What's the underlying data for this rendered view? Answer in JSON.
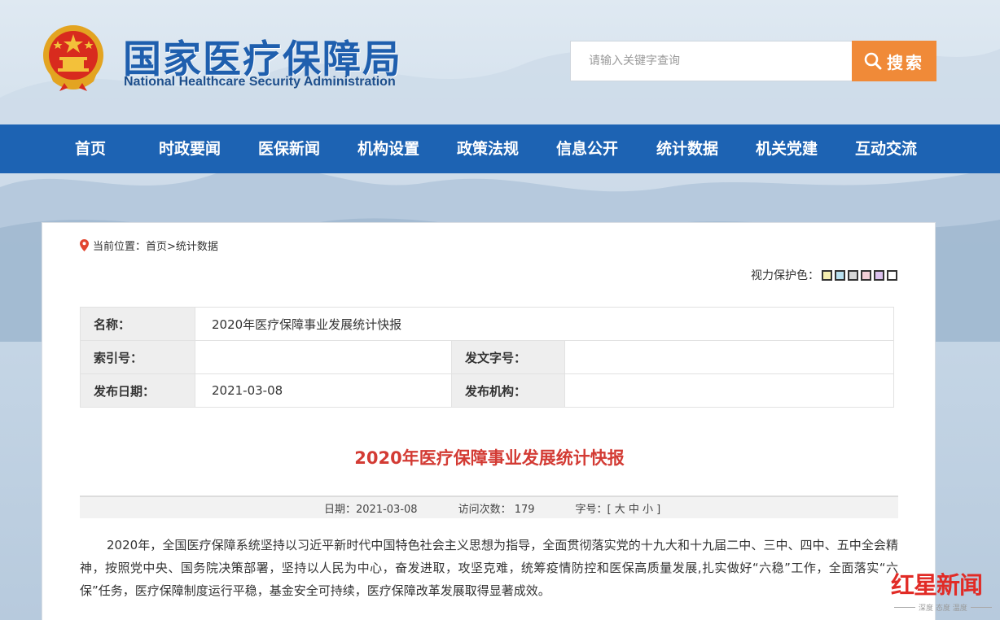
{
  "header": {
    "title_cn": "国家医疗保障局",
    "title_en": "National Healthcare Security Administration",
    "search_placeholder": "请输入关键字查询",
    "search_label": "搜索"
  },
  "nav": {
    "items": [
      "首页",
      "时政要闻",
      "医保新闻",
      "机构设置",
      "政策法规",
      "信息公开",
      "统计数据",
      "机关党建",
      "互动交流"
    ]
  },
  "breadcrumb": "当前位置：首页>统计数据",
  "eye_care": {
    "label": "视力保护色：",
    "colors": [
      "#f5eeb0",
      "#b9e0ef",
      "#d7d7d7",
      "#f2cfd6",
      "#dcc2ee",
      "#ffffff"
    ]
  },
  "meta": {
    "name_label": "名称：",
    "name_value": "2020年医疗保障事业发展统计快报",
    "index_label": "索引号：",
    "index_value": "",
    "doc_no_label": "发文字号：",
    "doc_no_value": "",
    "date_label": "发布日期：",
    "date_value": "2021-03-08",
    "org_label": "发布机构：",
    "org_value": ""
  },
  "article": {
    "title": "2020年医疗保障事业发展统计快报",
    "date_info": "日期：2021-03-08",
    "visits_info": "访问次数：  179",
    "font_info": "字号：[ 大 中 小 ]",
    "paragraph": "2020年，全国医疗保障系统坚持以习近平新时代中国特色社会主义思想为指导，全面贯彻落实党的十九大和十九届二中、三中、四中、五中全会精神，按照党中央、国务院决策部署，坚持以人民为中心，奋发进取，攻坚克难，统筹疫情防控和医保高质量发展,扎实做好“六稳”工作，全面落实“六保”任务，医疗保障制度运行平稳，基金安全可持续，医疗保障改革发展取得显著成效。"
  },
  "watermark": {
    "brand": "红星新闻",
    "slogan": "深度 态度 温度"
  }
}
